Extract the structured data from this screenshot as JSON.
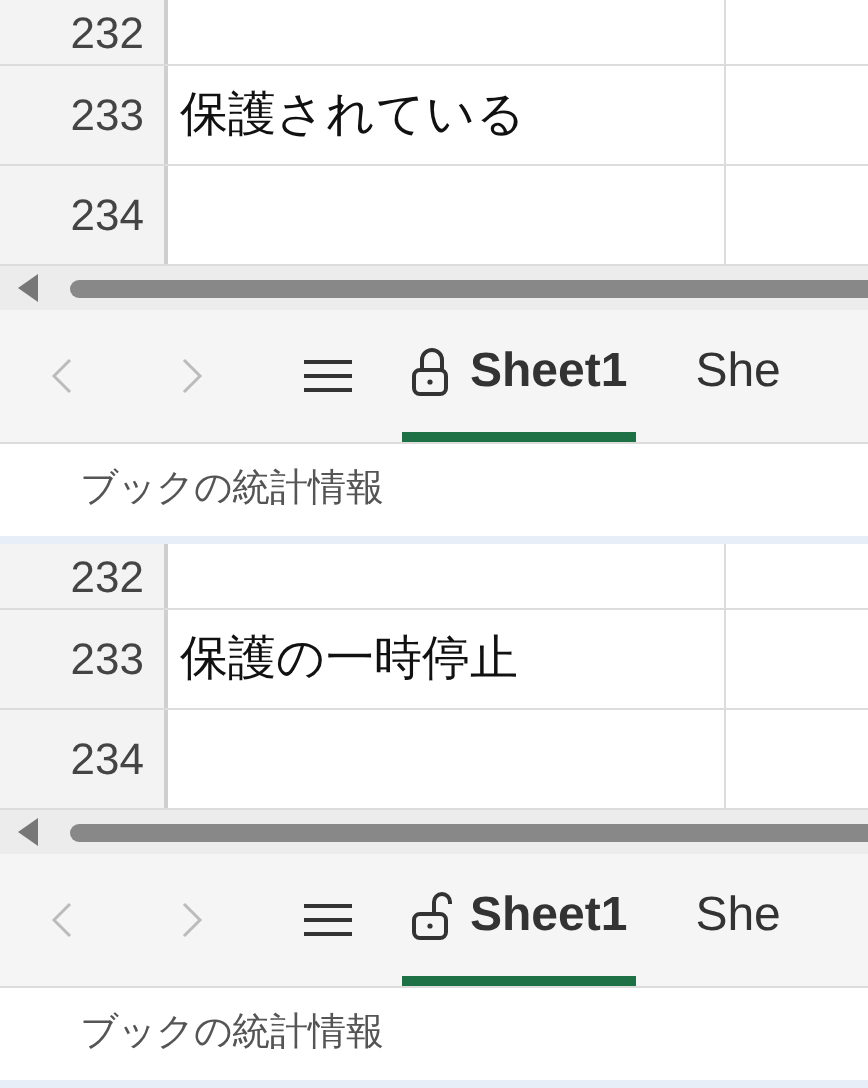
{
  "panels": [
    {
      "rows": [
        {
          "number": "232",
          "cells": [
            ""
          ]
        },
        {
          "number": "233",
          "cells": [
            "保護されている"
          ]
        },
        {
          "number": "234",
          "cells": [
            ""
          ]
        }
      ],
      "tabs": [
        {
          "label": "Sheet1",
          "selected": true,
          "locked": true
        },
        {
          "label": "She",
          "selected": false
        }
      ],
      "status": "ブックの統計情報"
    },
    {
      "rows": [
        {
          "number": "232",
          "cells": [
            ""
          ]
        },
        {
          "number": "233",
          "cells": [
            "保護の一時停止"
          ]
        },
        {
          "number": "234",
          "cells": [
            ""
          ]
        }
      ],
      "tabs": [
        {
          "label": "Sheet1",
          "selected": true,
          "locked": false
        },
        {
          "label": "She",
          "selected": false
        }
      ],
      "status": "ブックの統計情報"
    }
  ]
}
